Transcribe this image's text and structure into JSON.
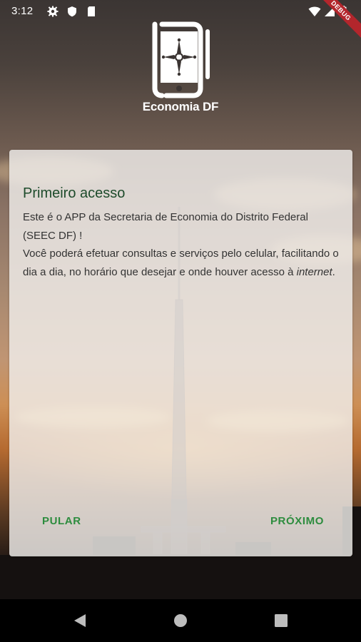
{
  "status_bar": {
    "time": "3:12",
    "icons": [
      "settings-icon",
      "shield-icon",
      "sd-card-icon",
      "wifi-icon",
      "signal-icon",
      "battery-icon"
    ],
    "debug_label": "DEBUG"
  },
  "app": {
    "name": "Economia DF",
    "logo_icon": "phone-compass-logo"
  },
  "card": {
    "title": "Primeiro acesso",
    "paragraph_1": "Este é o APP da Secretaria de Economia do Distrito Federal (SEEC DF) !",
    "paragraph_2_before": "Você poderá efetuar consultas e serviços pelo celular, facilitando o dia a dia, no horário que desejar e onde houver acesso à ",
    "paragraph_2_italic": "internet",
    "paragraph_2_after": ".",
    "skip_label": "PULAR",
    "next_label": "PRÓXIMO"
  },
  "colors": {
    "title_green": "#1d4b2b",
    "button_green": "#2d8c3e",
    "debug_red": "#b3262c"
  },
  "nav_bar": {
    "icons": [
      "back-icon",
      "home-icon",
      "recents-icon"
    ]
  }
}
